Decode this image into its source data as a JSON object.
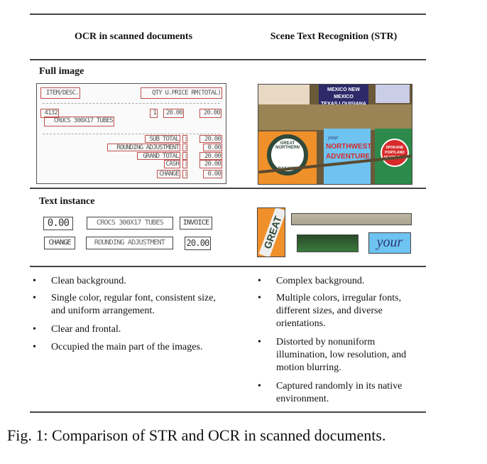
{
  "header": {
    "left": "OCR in scanned documents",
    "right": "Scene Text Recognition (STR)"
  },
  "sections": {
    "full_image": "Full image",
    "text_instance": "Text instance"
  },
  "receipt": {
    "item_desc": "ITEM/DESC.",
    "qty_header": "QTY U.PRICE RM(TOTAL)",
    "code": "4132",
    "product": "CROCS 300X17 TUBES",
    "qty": "1",
    "unit_price": "20.00",
    "total": "20.00",
    "summary": [
      {
        "label": "SUB TOTAL",
        "colon": ":",
        "value": "20.00"
      },
      {
        "label": "ROUNDING ADJUSTMENT",
        "colon": ":",
        "value": "0.00"
      },
      {
        "label": "GRAND TOTAL",
        "colon": ":",
        "value": "20.00"
      },
      {
        "label": "CASH",
        "colon": ":",
        "value": "20.00"
      },
      {
        "label": "CHANGE",
        "colon": ":",
        "value": "0.00"
      }
    ]
  },
  "scene": {
    "sign1": "MEXICO NEW MEXICO",
    "sign2": "TEXAS LOUISIANA",
    "great_northern": "GREAT NORTHERN",
    "railway": "RAILWAY",
    "your": "your",
    "northwest": "NORTHWEST",
    "adventure": "ADVENTURE",
    "spokane": "SPOKANE",
    "portland": "PORTLAND",
    "seattle": "SEATTLE RY"
  },
  "ocr_instances": [
    "0.00",
    "CROCS 300X17 TUBES",
    "INVOICE",
    "CHANGE",
    "ROUNDING ADJUSTMENT",
    "20.00"
  ],
  "str_instances": {
    "great": "GREAT",
    "your": "your"
  },
  "ocr_bullets": [
    "Clean background.",
    "Single color, regular font, consistent size, and uniform arrangement.",
    "Clear and frontal.",
    "Occupied the main part of the images."
  ],
  "str_bullets": [
    "Complex background.",
    "Multiple colors, irregular fonts, different sizes, and diverse orientations.",
    "Distorted by nonuniform illumination, low resolution, and motion blurring.",
    "Captured randomly in its native environment."
  ],
  "bullet_char": "•",
  "caption": "Fig. 1: Comparison of STR and OCR in scanned documents.",
  "colors": {
    "box_red": "#c0504d",
    "rule": "#444444"
  }
}
